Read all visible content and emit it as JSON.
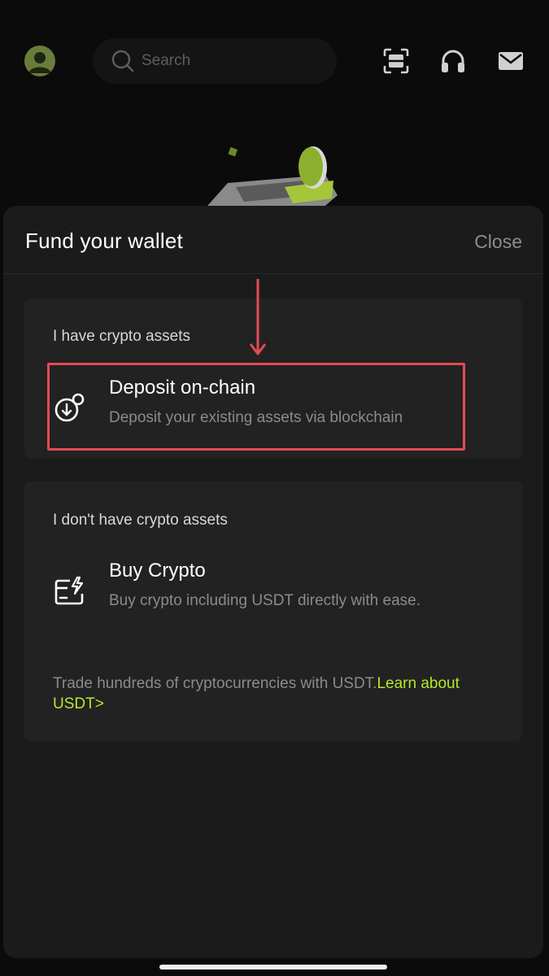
{
  "search": {
    "placeholder": "Search"
  },
  "sheet": {
    "title": "Fund your wallet",
    "close_label": "Close",
    "sections": [
      {
        "label": "I have crypto assets",
        "option": {
          "title": "Deposit on-chain",
          "description": "Deposit your existing assets via blockchain",
          "icon": "deposit-icon"
        }
      },
      {
        "label": "I don't have crypto assets",
        "option": {
          "title": "Buy Crypto",
          "description": "Buy crypto including USDT directly with ease.",
          "icon": "buy-card-icon"
        },
        "note": "Trade hundreds of cryptocurrencies with USDT.",
        "link": "Learn about USDT>"
      }
    ]
  },
  "icons": {
    "avatar": "avatar-icon",
    "search": "search-icon",
    "scan": "scan-icon",
    "support": "headset-icon",
    "mail": "mail-icon"
  },
  "colors": {
    "accent": "#b8e82a",
    "highlight": "#e34a55",
    "sheet_bg": "#1b1b1b",
    "card_bg": "#222222"
  }
}
